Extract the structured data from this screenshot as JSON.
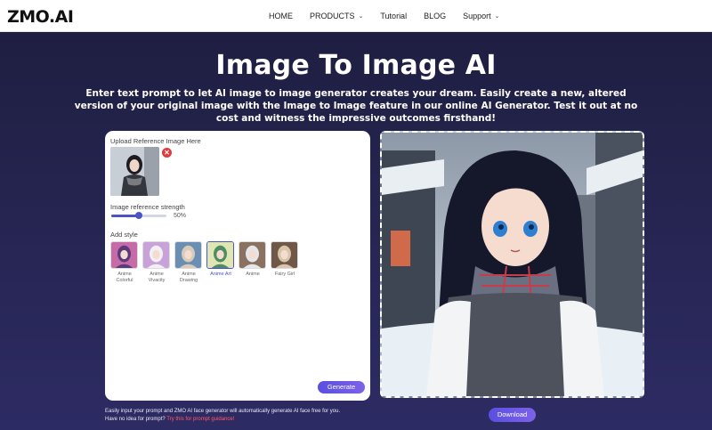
{
  "nav": {
    "logo": "ZMO.AI",
    "items": [
      {
        "label": "HOME",
        "dropdown": false
      },
      {
        "label": "PRODUCTS",
        "dropdown": true
      },
      {
        "label": "Tutorial",
        "dropdown": false
      },
      {
        "label": "BLOG",
        "dropdown": false
      },
      {
        "label": "Support",
        "dropdown": true
      }
    ]
  },
  "hero": {
    "title": "Image To Image AI",
    "subtitle": "Enter text prompt to let AI image to image generator creates your dream. Easily create a new, altered version of your original image with the Image to Image feature in our online AI Generator. Test it out at no cost and witness the impressive outcomes firsthand!"
  },
  "panel": {
    "upload_label": "Upload Reference Image Here",
    "remove_icon": "✕",
    "strength_label": "Image reference strength",
    "strength_value": 50,
    "strength_text": "50%",
    "style_label": "Add style",
    "styles": [
      {
        "name": "Anime Colorful",
        "selected": false,
        "colors": [
          "#5b3a7a",
          "#c76aa8"
        ]
      },
      {
        "name": "Anime Vivacity",
        "selected": false,
        "colors": [
          "#f2f0f4",
          "#c9a2d9"
        ]
      },
      {
        "name": "Anime Drawing",
        "selected": false,
        "colors": [
          "#d8ccb8",
          "#6b8fb2"
        ]
      },
      {
        "name": "Anime Art",
        "selected": true,
        "colors": [
          "#4f8c5f",
          "#dfe6b4"
        ]
      },
      {
        "name": "Anime",
        "selected": false,
        "colors": [
          "#e4e6ea",
          "#8b7160"
        ]
      },
      {
        "name": "Fairy Girl",
        "selected": false,
        "colors": [
          "#d8c4a8",
          "#705848"
        ]
      }
    ],
    "generate_label": "Generate"
  },
  "footer": {
    "hint_line1": "Easily input your prompt and ZMO AI face generator will automatically generate AI face free for you.",
    "hint_line2_prefix": "Have no idea for prompt?",
    "hint_link": "Try this for prompt guidance!",
    "download_label": "Download"
  },
  "colors": {
    "accent": "#5a4fe0",
    "link": "#ff5a6b",
    "remove": "#e0393e"
  }
}
